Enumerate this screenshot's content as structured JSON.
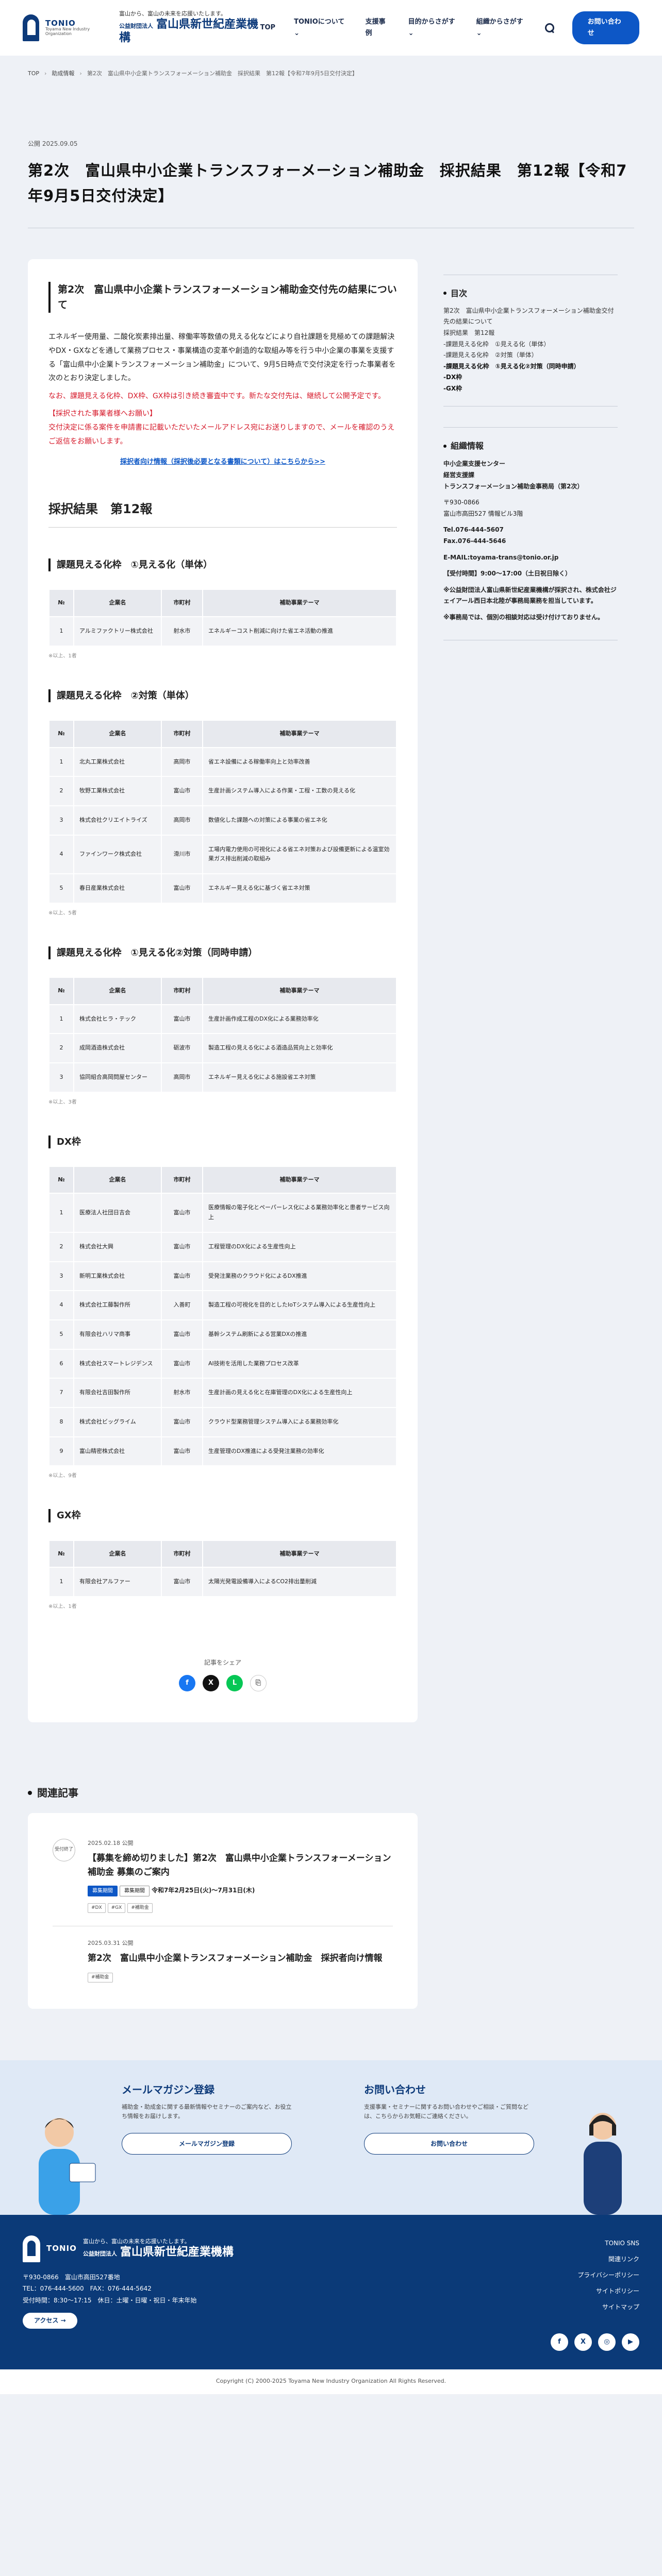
{
  "header": {
    "logo_en": "TONIO",
    "logo_en_sub": "Toyama New Industry Organization",
    "logo_tagline": "富山から、富山の未来を応援いたします。",
    "logo_prefix": "公益財団法人",
    "logo_name": "富山県新世紀産業機構",
    "nav": [
      "TOP",
      "TONIOについて",
      "支援事例",
      "目的からさがす",
      "組織からさがす"
    ],
    "contact_label": "お問い合わせ"
  },
  "breadcrumb": [
    "TOP",
    "助成情報",
    "第2次　富山県中小企業トランスフォーメーション補助金　採択結果　第12報【令和7年9月5日交付決定】"
  ],
  "article": {
    "date": "公開 2025.09.05",
    "title": "第2次　富山県中小企業トランスフォーメーション補助金　採択結果　第12報【令和7年9月5日交付決定】",
    "intro_title": "第2次　富山県中小企業トランスフォーメーション補助金交付先の結果について",
    "intro_p1": "エネルギー使用量、二酸化炭素排出量、稼働率等数値の見える化などにより自社課題を見極めての課題解決やDX・GXなどを通して業務プロセス・事業構造の変革や創造的な取組み等を行う中小企業の事業を支援する「富山県中小企業トランスフォーメーション補助金」について、9月5日時点で交付決定を行った事業者を次のとおり決定しました。",
    "intro_p2": "なお、課題見える化枠、DX枠、GX枠は引き続き審査中です。新たな交付先は、継続して公開予定です。",
    "intro_p3": "【採択された事業者様へお願い】",
    "intro_p4": "交付決定に係る案件を申請書に記載いただいたメールアドレス宛にお送りしますので、メールを確認のうえご返信をお願いします。",
    "intro_link": "採択者向け情報（採択後必要となる書類について）はこちらから>>",
    "h2": "採択結果　第12報",
    "col_no": "№",
    "col_company": "企業名",
    "col_city": "市町村",
    "col_theme": "補助事業テーマ",
    "share_label": "記事をシェア"
  },
  "sections": [
    {
      "title": "課題見える化枠　①見える化（単体）",
      "note": "※以上、1者",
      "rows": [
        [
          "1",
          "アルミファクトリー株式会社",
          "射水市",
          "エネルギーコスト削減に向けた省エネ活動の推進"
        ]
      ]
    },
    {
      "title": "課題見える化枠　②対策（単体）",
      "note": "※以上、5者",
      "rows": [
        [
          "1",
          "北丸工業株式会社",
          "高岡市",
          "省エネ設備による稼働率向上と効率改善"
        ],
        [
          "2",
          "牧野工業株式会社",
          "富山市",
          "生産計画システム導入による作業・工程・工数の見える化"
        ],
        [
          "3",
          "株式会社クリエイトライズ",
          "高岡市",
          "数値化した課題への対策による事業の省エネ化"
        ],
        [
          "4",
          "ファインワーク株式会社",
          "滑川市",
          "工場内電力使用の可視化による省エネ対策および設備更新による温室効果ガス排出削減の取組み"
        ],
        [
          "5",
          "春日産業株式会社",
          "富山市",
          "エネルギー見える化に基づく省エネ対策"
        ]
      ]
    },
    {
      "title": "課題見える化枠　①見える化②対策（同時申請）",
      "note": "※以上、3者",
      "rows": [
        [
          "1",
          "株式会社ヒラ・テック",
          "富山市",
          "生産計画作成工程のDX化による業務効率化"
        ],
        [
          "2",
          "成岡酒造株式会社",
          "砺波市",
          "製造工程の見える化による酒造品質向上と効率化"
        ],
        [
          "3",
          "協同組合高岡問屋センター",
          "高岡市",
          "エネルギー見える化による施設省エネ対策"
        ]
      ]
    },
    {
      "title": "DX枠",
      "note": "※以上、9者",
      "rows": [
        [
          "1",
          "医療法人社団日吉会",
          "富山市",
          "医療情報の電子化とペーパーレス化による業務効率化と患者サービス向上"
        ],
        [
          "2",
          "株式会社大興",
          "富山市",
          "工程管理のDX化による生産性向上"
        ],
        [
          "3",
          "新明工業株式会社",
          "富山市",
          "受発注業務のクラウド化によるDX推進"
        ],
        [
          "4",
          "株式会社工藤製作所",
          "入善町",
          "製造工程の可視化を目的としたIoTシステム導入による生産性向上"
        ],
        [
          "5",
          "有限会社ハリマ商事",
          "富山市",
          "基幹システム刷新による営業DXの推進"
        ],
        [
          "6",
          "株式会社スマートレジデンス",
          "富山市",
          "AI技術を活用した業務プロセス改革"
        ],
        [
          "7",
          "有限会社吉田製作所",
          "射水市",
          "生産計画の見える化と在庫管理のDX化による生産性向上"
        ],
        [
          "8",
          "株式会社ビッグライム",
          "富山市",
          "クラウド型業務管理システム導入による業務効率化"
        ],
        [
          "9",
          "富山精密株式会社",
          "富山市",
          "生産管理のDX推進による受発注業務の効率化"
        ]
      ]
    },
    {
      "title": "GX枠",
      "note": "※以上、1者",
      "rows": [
        [
          "1",
          "有限会社アルファー",
          "富山市",
          "太陽光発電設備導入によるCO2排出量削減"
        ]
      ]
    }
  ],
  "sidebar": {
    "toc_title": "目次",
    "toc": [
      {
        "t": "第2次　富山県中小企業トランスフォーメーション補助金交付先の結果について",
        "b": false
      },
      {
        "t": "採択結果　第12報",
        "b": false
      },
      {
        "t": "-課題見える化枠　①見える化（単体）",
        "b": false
      },
      {
        "t": "-課題見える化枠　②対策（単体）",
        "b": false
      },
      {
        "t": "-課題見える化枠　①見える化②対策（同時申請）",
        "b": true
      },
      {
        "t": "-DX枠",
        "b": true
      },
      {
        "t": "-GX枠",
        "b": true
      }
    ],
    "org_title": "組織情報",
    "org_name1": "中小企業支援センター",
    "org_name2": "経営支援課",
    "org_name3": "トランスフォーメーション補助金事務局（第2次）",
    "org_zip": "〒930-0866",
    "org_addr": "富山市高田527 情報ビル3階",
    "org_tel": "Tel.076-444-5607",
    "org_fax": "Fax.076-444-5646",
    "org_mail": "E-MAIL:toyama-trans@tonio.or.jp",
    "org_hours": "【受付時間】9:00～17:00（土日祝日除く）",
    "org_note1": "※公益財団法人富山県新世紀産業機構が採択され、株式会社ジェイアール西日本北陸が事務局業務を担当しています。",
    "org_note2": "※事務局では、個別の相談対応は受け付けておりません。"
  },
  "related": {
    "title": "関連記事",
    "items": [
      {
        "badge": "受付終了",
        "date": "2025.02.18 公開",
        "title": "【募集を締め切りました】第2次　富山県中小企業トランスフォーメーション補助金 募集のご案内",
        "pills": [
          "募集期間",
          "募集期間"
        ],
        "period": "令和7年2月25日(火)～7月31日(木)",
        "tags": [
          "#DX",
          "#GX",
          "#補助金"
        ]
      },
      {
        "badge": "",
        "date": "2025.03.31 公開",
        "title": "第2次　富山県中小企業トランスフォーメーション補助金　採択者向け情報",
        "pills": [],
        "period": "",
        "tags": [
          "#補助金"
        ]
      }
    ]
  },
  "cta": {
    "mail_title": "メールマガジン登録",
    "mail_desc": "補助金・助成金に関する最新情報やセミナーのご案内など、お役立ち情報をお届けします。",
    "mail_btn": "メールマガジン登録",
    "contact_title": "お問い合わせ",
    "contact_desc": "支援事業・セミナーに関するお問い合わせやご相談・ご質問などは、こちらからお気軽にご連絡ください。",
    "contact_btn": "お問い合わせ"
  },
  "footer": {
    "zip_addr": "〒930-0866　富山市高田527番地",
    "tel_fax": "TEL：076-444-5600　FAX：076-444-5642",
    "hours": "受付時間：8:30～17:15　休日：土曜・日曜・祝日・年末年始",
    "access": "アクセス",
    "links": [
      "TONIO SNS",
      "関連リンク",
      "プライバシーポリシー",
      "サイトポリシー",
      "サイトマップ"
    ],
    "social": [
      "f",
      "X",
      "◎",
      "▶"
    ],
    "copyright": "Copyright (C) 2000-2025 Toyama New Industry Organization All Rights Reserved."
  }
}
